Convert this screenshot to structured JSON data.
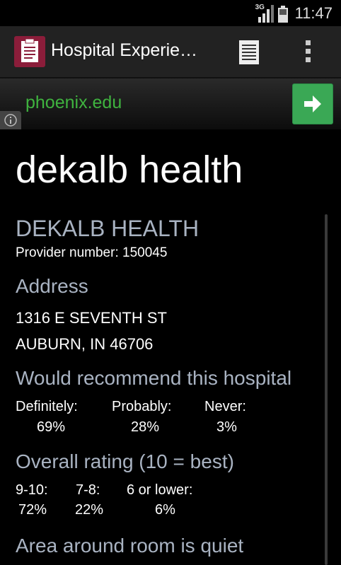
{
  "status_bar": {
    "network": "3G",
    "time": "11:47"
  },
  "action_bar": {
    "title": "Hospital Experie…",
    "icons": [
      "clipboard-icon",
      "list-icon",
      "overflow-menu-icon"
    ]
  },
  "ad": {
    "text": "phoenix.edu",
    "icons": [
      "arrow-right-icon",
      "info-icon"
    ]
  },
  "page": {
    "title": "dekalb health"
  },
  "hospital": {
    "name": "DEKALB HEALTH",
    "provider_number": "Provider number: 150045"
  },
  "address": {
    "heading": "Address",
    "line1": "1316 E SEVENTH ST",
    "line2": "AUBURN, IN 46706"
  },
  "recommend": {
    "heading": "Would recommend this hospital",
    "items": [
      {
        "label": "Definitely:",
        "value": "69%"
      },
      {
        "label": "Probably:",
        "value": "28%"
      },
      {
        "label": "Never:",
        "value": "3%"
      }
    ]
  },
  "overall": {
    "heading": "Overall rating (10 = best)",
    "items": [
      {
        "label": "9-10:",
        "value": "72%"
      },
      {
        "label": "7-8:",
        "value": "22%"
      },
      {
        "label": "6 or lower:",
        "value": "6%"
      }
    ]
  },
  "quiet": {
    "heading": "Area around room is quiet"
  },
  "colors": {
    "heading": "#a9b3c2",
    "accent": "#3aa855",
    "app_icon": "#8b1d3a"
  }
}
